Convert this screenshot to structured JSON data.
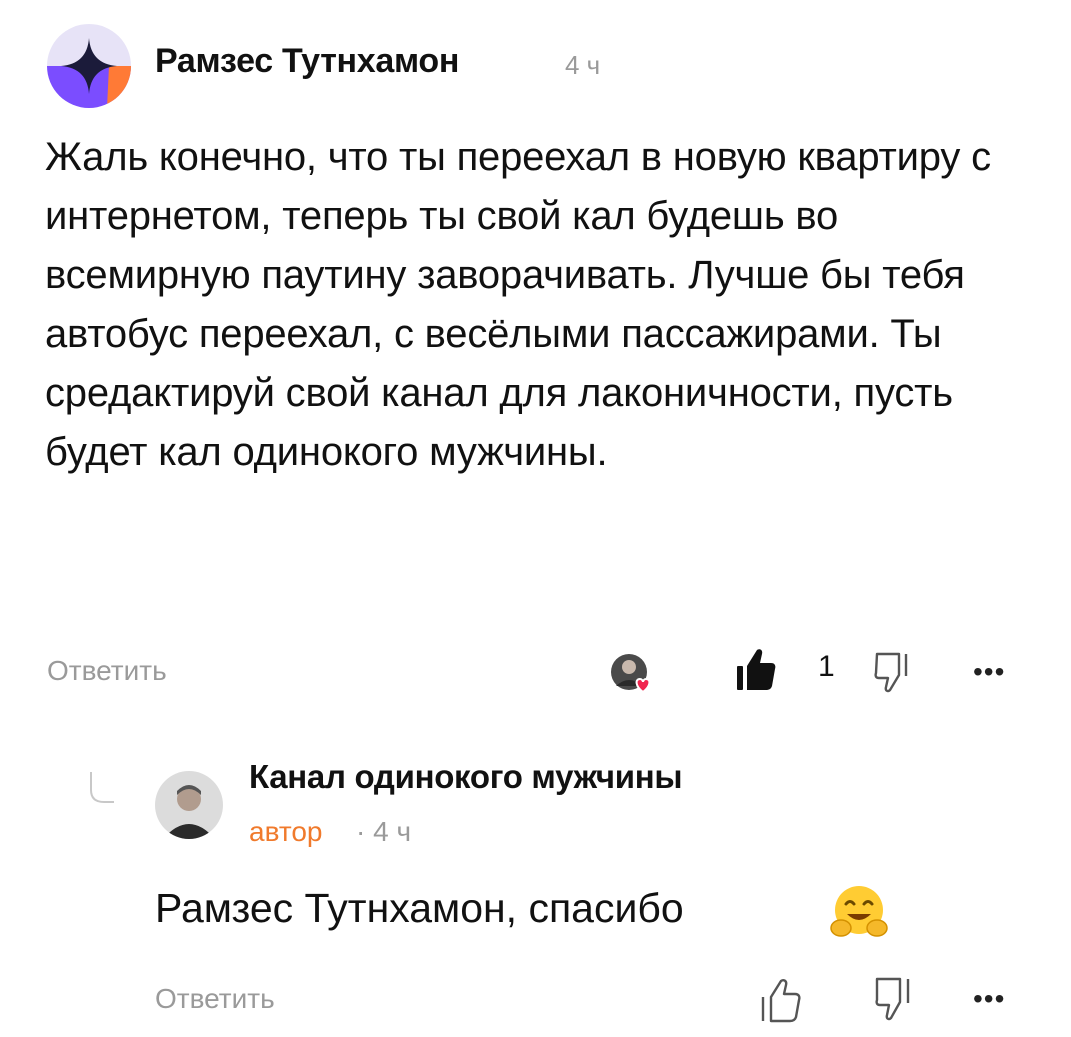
{
  "comment": {
    "author": "Рамзес Тутнхамон",
    "time": "4 ч",
    "text": "Жаль конечно, что ты переехал в новую квартиру с интернетом, теперь ты свой кал будешь во всемирную паутину заворачивать. Лучше бы тебя автобус переехал, с весёлыми пассажирами. Ты средактируй свой канал для лаконичности, пусть будет кал одинокого мужчины.",
    "reply_label": "Ответить",
    "like_count": "1",
    "more_label": "•••",
    "icons": [
      "avatar-sparkle-icon",
      "liked-by-author-icon",
      "thumbs-up-filled-icon",
      "thumbs-down-icon",
      "more-icon"
    ]
  },
  "reply": {
    "author": "Канал одинокого мужчины",
    "badge": "автор",
    "time": "· 4 ч",
    "text": "Рамзес Тутнхамон, спасибо",
    "emoji": "hugging-face",
    "reply_label": "Ответить",
    "more_label": "•••",
    "icons": [
      "reply-thread-icon",
      "thumbs-up-icon",
      "thumbs-down-icon",
      "more-icon"
    ]
  },
  "colors": {
    "author_badge": "#f07a2c",
    "avatar_purple": "#7b4dff",
    "avatar_orange": "#ff7a36",
    "heart": "#f0264f",
    "muted": "#9a9a9a"
  }
}
